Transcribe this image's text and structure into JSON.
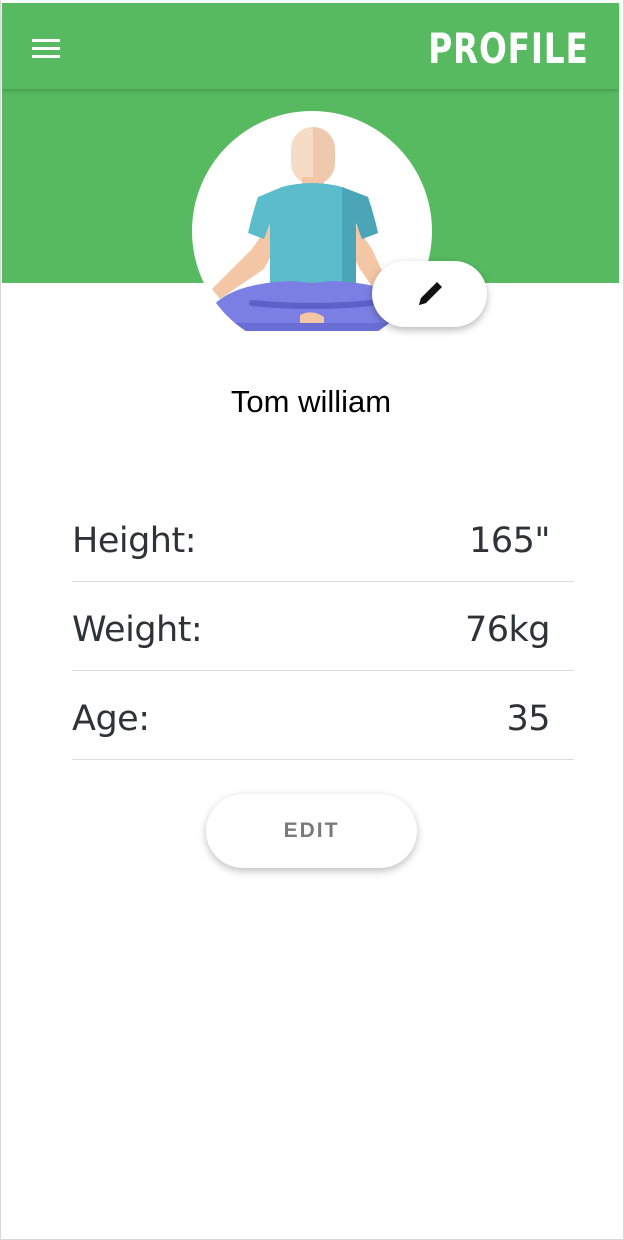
{
  "appbar": {
    "title": "PROFILE",
    "menu_icon": "hamburger-menu-icon",
    "background_color": "#57ba60"
  },
  "profile": {
    "avatar_icon": "meditating-person-avatar",
    "edit_photo_icon": "pencil-icon",
    "name": "Tom william"
  },
  "stats": [
    {
      "label": "Height:",
      "value": "165\""
    },
    {
      "label": "Weight:",
      "value": "76kg"
    },
    {
      "label": "Age:",
      "value": "35"
    }
  ],
  "actions": {
    "edit_label": "EDIT"
  }
}
